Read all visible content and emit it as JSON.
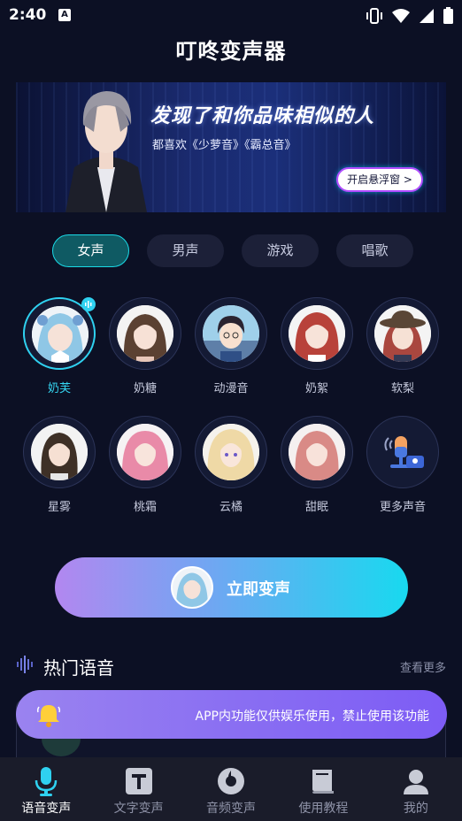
{
  "status": {
    "time": "2:40",
    "a_label": "A"
  },
  "app": {
    "title": "叮咚变声器"
  },
  "banner": {
    "headline": "发现了和你品味相似的人",
    "subtitle": "都喜欢《少萝音》《霸总音》",
    "button_label": "开启悬浮窗 >"
  },
  "tabs": [
    {
      "label": "女声",
      "active": true
    },
    {
      "label": "男声",
      "active": false
    },
    {
      "label": "游戏",
      "active": false
    },
    {
      "label": "唱歌",
      "active": false
    }
  ],
  "voices": [
    {
      "name": "奶芙",
      "active": true
    },
    {
      "name": "奶糖"
    },
    {
      "name": "动漫音"
    },
    {
      "name": "奶絮"
    },
    {
      "name": "软梨"
    },
    {
      "name": "星雾"
    },
    {
      "name": "桃霜"
    },
    {
      "name": "云橘"
    },
    {
      "name": "甜眠"
    },
    {
      "name": "更多声音"
    }
  ],
  "convert": {
    "label": "立即变声"
  },
  "hot": {
    "title": "热门语音",
    "more": "查看更多"
  },
  "toast": {
    "text": "APP内功能仅供娱乐使用，禁止使用该功能"
  },
  "nav": [
    {
      "label": "语音变声",
      "icon": "microphone-icon",
      "active": true
    },
    {
      "label": "文字变声",
      "icon": "text-t-icon"
    },
    {
      "label": "音频变声",
      "icon": "disc-icon"
    },
    {
      "label": "使用教程",
      "icon": "book-icon"
    },
    {
      "label": "我的",
      "icon": "profile-icon"
    }
  ],
  "colors": {
    "accent": "#2fd1f0",
    "background": "#0c1024",
    "active_tab": "#0f5a63",
    "toast": "#8a6ff2"
  }
}
